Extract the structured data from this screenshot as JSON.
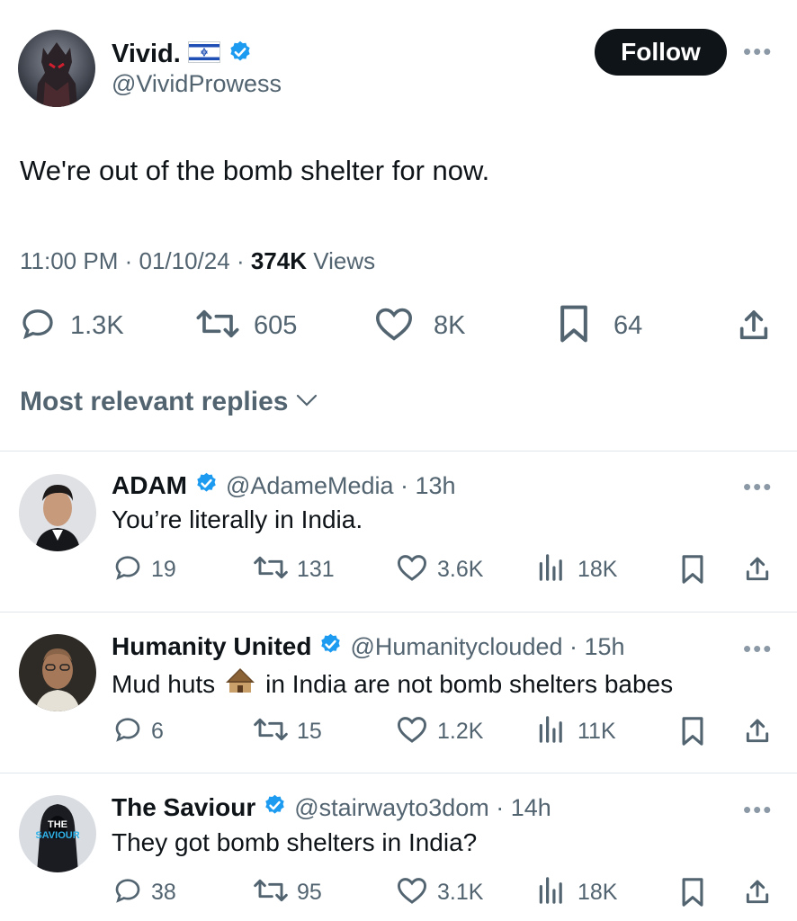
{
  "tweet": {
    "author_name": "Vivid.",
    "author_handle": "@VividProwess",
    "follow_label": "Follow",
    "more_label": "•••",
    "text": "We're out of the bomb shelter for now.",
    "time": "11:00 PM",
    "date": "01/10/24",
    "views_count": "374K",
    "views_label": "Views",
    "replies": "1.3K",
    "reposts": "605",
    "likes": "8K",
    "bookmarks": "64"
  },
  "replies_header": "Most relevant replies",
  "replies": [
    {
      "name": "ADAM",
      "handle": "@AdameMedia",
      "time": "13h",
      "text": "You’re literally in India.",
      "reply_count": "19",
      "repost_count": "131",
      "like_count": "3.6K",
      "view_count": "18K"
    },
    {
      "name": "Humanity United",
      "handle": "@Humanityclouded",
      "time": "15h",
      "text_before": "Mud huts",
      "text_after": "in India are not bomb shelters babes",
      "reply_count": "6",
      "repost_count": "15",
      "like_count": "1.2K",
      "view_count": "11K"
    },
    {
      "name": "The Saviour",
      "handle": "@stairwayto3dom",
      "time": "14h",
      "text": "They got bomb shelters in India?",
      "avatar_text_1": "THE",
      "avatar_text_2": "SAVIOUR",
      "reply_count": "38",
      "repost_count": "95",
      "like_count": "3.1K",
      "view_count": "18K"
    }
  ],
  "colors": {
    "verified": "#1d9bf0",
    "text": "#0f1419",
    "secondary": "#536471",
    "follow_bg": "#0f1419"
  }
}
